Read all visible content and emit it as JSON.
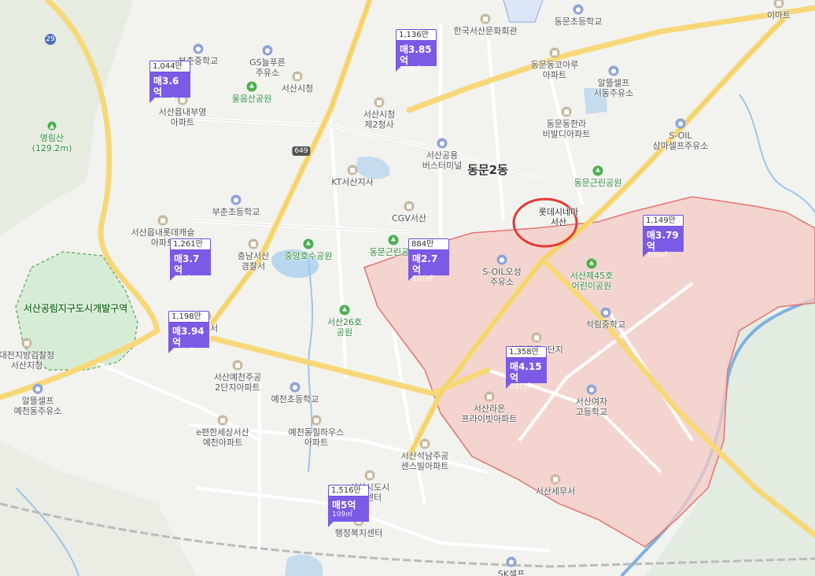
{
  "map": {
    "district_label": "동문2동",
    "zone_label": "서산공림지구도시개발구역",
    "route_649": "649",
    "route_29": "29",
    "highlighted_place": "롯데시네마\n서산",
    "highlight_color": "#e53935",
    "zone_color": "#e57373",
    "marker_color": "#7b5ae6"
  },
  "places": [
    {
      "id": "p1",
      "name": "한국서산문화회관",
      "type": "poi"
    },
    {
      "id": "p2",
      "name": "동문초등학교",
      "type": "school"
    },
    {
      "id": "p3",
      "name": "이마트",
      "type": "poi"
    },
    {
      "id": "p4",
      "name": "부춘중학교",
      "type": "school"
    },
    {
      "id": "p5",
      "name": "GS늘푸른\n주유소",
      "type": "gas"
    },
    {
      "id": "p6",
      "name": "동문동코아루\n아파트",
      "type": "poi"
    },
    {
      "id": "p7",
      "name": "알뜰셀프\n서동주유소",
      "type": "gas"
    },
    {
      "id": "p8",
      "name": "울음산공원",
      "type": "park"
    },
    {
      "id": "p9",
      "name": "서산시청",
      "type": "poi"
    },
    {
      "id": "p10",
      "name": "서산읍내부영\n아파트",
      "type": "poi"
    },
    {
      "id": "p11",
      "name": "서산시청\n제2청사",
      "type": "poi"
    },
    {
      "id": "p12",
      "name": "동문동한라\n비발디아파트",
      "type": "poi"
    },
    {
      "id": "p13",
      "name": "명림산\n(129.2m)",
      "type": "mtn"
    },
    {
      "id": "p14",
      "name": "S-OIL\n삼마셀프주유소",
      "type": "gas"
    },
    {
      "id": "p15",
      "name": "서산공용\n버스터미널",
      "type": "bus"
    },
    {
      "id": "p16",
      "name": "KT서산지사",
      "type": "poi"
    },
    {
      "id": "p17",
      "name": "동문근린공원",
      "type": "park"
    },
    {
      "id": "p18",
      "name": "부춘초등학교",
      "type": "school"
    },
    {
      "id": "p19",
      "name": "CGV서산",
      "type": "poi"
    },
    {
      "id": "p20",
      "name": "서산읍내롯데캐슬\n아파트",
      "type": "poi"
    },
    {
      "id": "p21",
      "name": "충남서산\n경찰서",
      "type": "poi"
    },
    {
      "id": "p22",
      "name": "중앙호수공원",
      "type": "park"
    },
    {
      "id": "p23",
      "name": "동문근린공원",
      "type": "park"
    },
    {
      "id": "p24",
      "name": "S-OIL오성\n주유소",
      "type": "gas"
    },
    {
      "id": "p25",
      "name": "서산제45호\n어린이공원",
      "type": "park"
    },
    {
      "id": "p26",
      "name": "서산26호\n공원",
      "type": "park"
    },
    {
      "id": "p27",
      "name": "석림중학교",
      "type": "school"
    },
    {
      "id": "p28",
      "name": "소방서",
      "type": "poi"
    },
    {
      "id": "p29",
      "name": "대전지방검찰청\n서산지청",
      "type": "poi"
    },
    {
      "id": "p30",
      "name": "서산예천주공\n2단지아파트",
      "type": "poi"
    },
    {
      "id": "p31",
      "name": "석림주공2단지",
      "type": "poi"
    },
    {
      "id": "p32",
      "name": "알뜰셀프\n예천동주유소",
      "type": "gas"
    },
    {
      "id": "p33",
      "name": "예천초등학교",
      "type": "school"
    },
    {
      "id": "p34",
      "name": "서산라온\n프라이빗아파트",
      "type": "poi"
    },
    {
      "id": "p35",
      "name": "서산여자\n고등학교",
      "type": "school"
    },
    {
      "id": "p36",
      "name": "e편한세상서산\n예천아파트",
      "type": "poi"
    },
    {
      "id": "p37",
      "name": "예천동힐하우스\n아파트",
      "type": "poi"
    },
    {
      "id": "p38",
      "name": "서산석남주공\n센스빌아파트",
      "type": "poi"
    },
    {
      "id": "p39",
      "name": "서산시도시\n합센터",
      "type": "poi"
    },
    {
      "id": "p40",
      "name": "서산세무서",
      "type": "poi"
    },
    {
      "id": "p41",
      "name": "행정복지센터",
      "type": "poi"
    },
    {
      "id": "p42",
      "name": "SK셀프\n서산제일주유소",
      "type": "gas"
    }
  ],
  "listings": [
    {
      "id": "m1",
      "count": "1,044만",
      "price": "매3.6억",
      "area": "114㎡"
    },
    {
      "id": "m2",
      "count": "1,136만",
      "price": "매3.85억",
      "area": "112㎡"
    },
    {
      "id": "m3",
      "count": "1,261만",
      "price": "매3.7억",
      "area": "97㎡"
    },
    {
      "id": "m4",
      "count": "884만",
      "price": "매2.7억",
      "area": "101㎡"
    },
    {
      "id": "m5",
      "count": "1,149만",
      "price": "매3.79억",
      "area": "109㎡"
    },
    {
      "id": "m6",
      "count": "1,198만",
      "price": "매3.94억",
      "area": "109㎡"
    },
    {
      "id": "m7",
      "count": "1,358만",
      "price": "매4.15억",
      "area": "101㎡"
    },
    {
      "id": "m8",
      "count": "1,516만",
      "price": "매5억",
      "area": "109㎡"
    }
  ]
}
